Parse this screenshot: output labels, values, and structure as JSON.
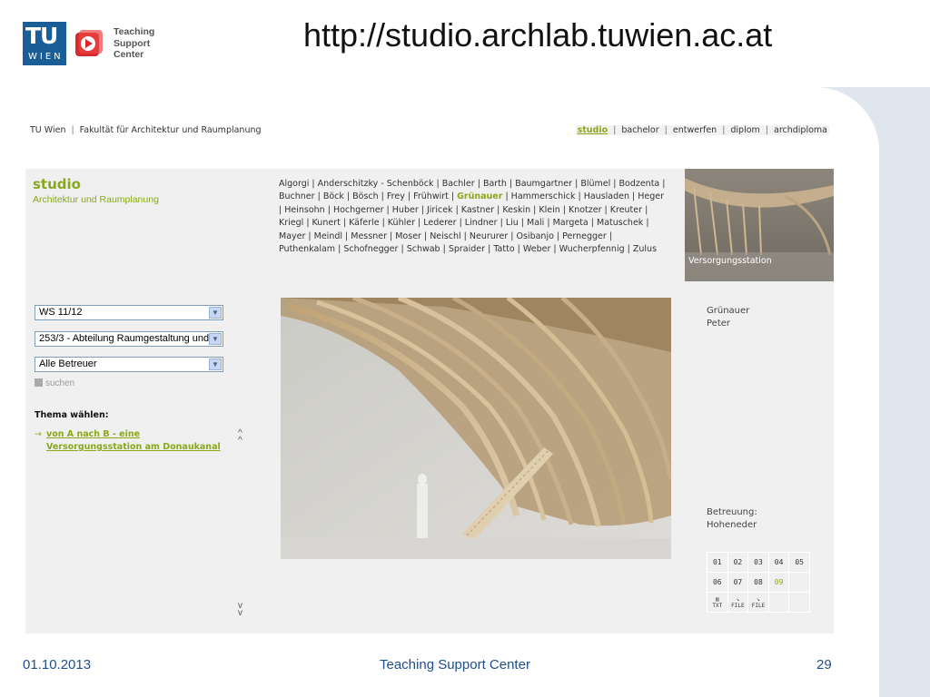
{
  "slide": {
    "title": "http://studio.archlab.tuwien.ac.at",
    "footer_date": "01.10.2013",
    "footer_center": "Teaching Support Center",
    "page_number": "29",
    "colors": {
      "brand_blue": "#1b5d96",
      "accent_green": "#8aa81a",
      "footer_text": "#1f4e8c",
      "frame": "#dfe6ee"
    }
  },
  "logo": {
    "tu_text": "TU",
    "wien_text": "WIEN",
    "tsc_lines": [
      "Teaching",
      "Support",
      "Center"
    ]
  },
  "site": {
    "breadcrumb": {
      "root": "TU Wien",
      "faculty": "Fakultät für Architektur und Raumplanung"
    },
    "nav": [
      {
        "label": "studio",
        "active": true
      },
      {
        "label": "bachelor",
        "active": false
      },
      {
        "label": "entwerfen",
        "active": false
      },
      {
        "label": "diplom",
        "active": false
      },
      {
        "label": "archdiploma",
        "active": false
      }
    ],
    "studio_title": "studio",
    "studio_subtitle": "Architektur und Raumplanung",
    "names": [
      "Algorgi",
      "Anderschitzky - Schenböck",
      "Bachler",
      "Barth",
      "Baumgartner",
      "Blümel",
      "Bodzenta",
      "Buchner",
      "Böck",
      "Bösch",
      "Frey",
      "Frühwirt",
      "Grünauer",
      "Hammerschick",
      "Hausladen",
      "Heger",
      "Heinsohn",
      "Hochgerner",
      "Huber",
      "Jiricek",
      "Kastner",
      "Keskin",
      "Klein",
      "Knotzer",
      "Kreuter",
      "Kriegl",
      "Kunert",
      "Käferle",
      "Kühler",
      "Lederer",
      "Lindner",
      "Liu",
      "Mali",
      "Margeta",
      "Matuschek",
      "Mayer",
      "Meindl",
      "Messner",
      "Moser",
      "Neischl",
      "Neururer",
      "Osibanjo",
      "Pernegger",
      "Puthenkalam",
      "Schofnegger",
      "Schwab",
      "Spraider",
      "Tatto",
      "Weber",
      "Wucherpfennig",
      "Zulus"
    ],
    "highlighted_name": "Grünauer",
    "thumb_label": "Versorgungsstation",
    "filters": {
      "semester": "WS 11/12",
      "department": "253/3 - Abteilung Raumgestaltung und",
      "supervisor": "Alle Betreuer",
      "search_label": "suchen"
    },
    "thema_heading": "Thema wählen:",
    "topic_link": "von A nach B - eine Versorgungsstation am Donaukanal",
    "scroll_up": "^",
    "scroll_down": "v",
    "author": [
      "Grünauer",
      "Peter"
    ],
    "supervision_label": "Betreuung:",
    "supervisor_name": "Hoheneder",
    "pages_row1": [
      "01",
      "02",
      "03",
      "04",
      "05"
    ],
    "pages_row2": [
      "06",
      "07",
      "08",
      "09",
      ""
    ],
    "current_page": "09",
    "files": [
      "TXT",
      "FILE",
      "FILE"
    ]
  }
}
